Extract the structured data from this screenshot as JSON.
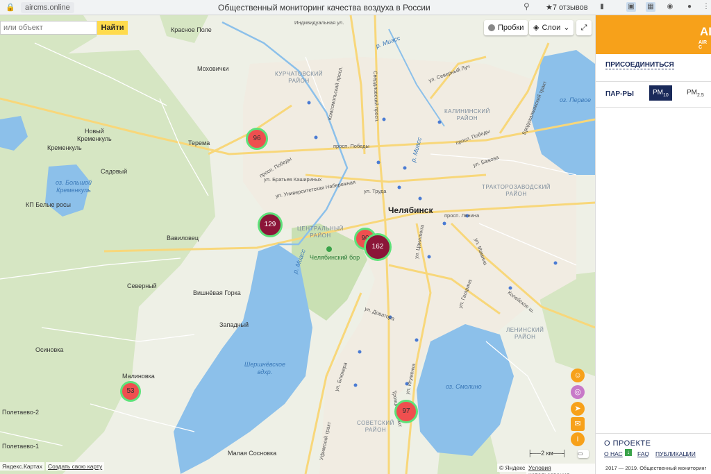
{
  "browser": {
    "lock_glyph": "🔒",
    "url": "aircms.online",
    "page_title": "Общественный мониторинг качества воздуха в России",
    "reviews": "★7 отзывов"
  },
  "search": {
    "placeholder": "или объект",
    "button": "Найти"
  },
  "map_controls": {
    "traffic": "Пробки",
    "layers": "Слои"
  },
  "places": {
    "krasnoe_pole": "Красное Поле",
    "mokhovichki": "Моховички",
    "novy_kremenkul": "Новый\nКременкуль",
    "kremenkul": "Кременкуль",
    "sadovy": "Садовый",
    "kp_belye_rosy": "КП Белые росы",
    "terema": "Терема",
    "vavilovets": "Вавиловец",
    "severny": "Северный",
    "vishnyovaya_gorka": "Вишнёвая Горка",
    "zapadny": "Западный",
    "osinovka": "Осиновка",
    "malinovka": "Малиновка",
    "poletaevo2": "Полетаево-2",
    "poletaevo1": "Полетаево-1",
    "malaya_sosnovka": "Малая Сосновка",
    "chelyabinsk": "Челябинск",
    "chelyabinsky_bor": "Челябинский бор"
  },
  "districts": {
    "kurchatovsky": "КУРЧАТОВСКИЙ\nРАЙОН",
    "kalininsky": "КАЛИНИНСКИЙ\nРАЙОН",
    "traktorozavodsky": "ТРАКТОРОЗАВОДСКИЙ\nРАЙОН",
    "centralny": "ЦЕНТРАЛЬНЫЙ\nРАЙОН",
    "leninsky": "ЛЕНИНСКИЙ\nРАЙОН",
    "sovetsky": "СОВЕТСКИЙ\nРАЙОН"
  },
  "streets": {
    "individualnaya": "Индивидуальная ул.",
    "komsomolsky": "Комсомольский просп.",
    "pobedy1": "просп. Победы",
    "pobedy2": "просп. Победы",
    "pobedy3": "просп. Победы",
    "bratyev": "ул. Братьев Кашириных",
    "universitetskaya": "ул. Университетская Набережная",
    "truda": "ул. Труда",
    "lenina": "просп. Ленина",
    "ufimsky": "Уфимский тракт",
    "blyukhera": "ул. Блюхера",
    "dovatora": "ул. Доватора",
    "igumnova": "ул. Игуменка",
    "tsvillinga": "ул. Цвиллинга",
    "sverdlovsky": "Свердловский просп.",
    "brodokalmaksky": "Бродокалмакский тракт",
    "kopeyskoe": "Копейское ш.",
    "bazhova": "ул. Бажова",
    "severny_luch": "ул. Северный Луч",
    "gagarina": "ул. Гагарина",
    "troitsky": "Троицкий тракт",
    "mamina": "ул. Мамина"
  },
  "water": {
    "bolshoy_kremenkul": "оз. Большой\nКременкуль",
    "shershnevskoe": "Шершнёвское\nвдхр.",
    "smolino": "оз. Смолино",
    "pervoe": "оз. Первое",
    "miass1": "р. Миасс",
    "miass2": "р. Миасс",
    "miass3": "р. Миасс"
  },
  "markers": [
    {
      "label": "96",
      "level": "red"
    },
    {
      "label": "129",
      "level": "maroon"
    },
    {
      "label": "90",
      "level": "red"
    },
    {
      "label": "162",
      "level": "maroon"
    },
    {
      "label": "53",
      "level": "red"
    },
    {
      "label": "97",
      "level": "red"
    }
  ],
  "scale_label": "2 км",
  "attribution": {
    "yandex_maps": "Яндекс.Картах",
    "create_map": "Создать свою карту",
    "copyright": "© Яндекс",
    "terms": "Условия использования"
  },
  "panel": {
    "brand": "AIR",
    "brand_sub": "AIR C",
    "join": "ПРИСОЕДИНИТЬСЯ",
    "params_label": "ПАР-РЫ",
    "pm10_base": "PM",
    "pm10_sub": "10",
    "pm25_base": "PM",
    "pm25_sub": "2.5",
    "about_title": "О ПРОЕКТЕ",
    "about_us": "О НАС",
    "faq": "FAQ",
    "publications": "ПУБЛИКАЦИИ",
    "footer": "2017 — 2019. Общественный мониторинг"
  },
  "colors": {
    "accent_orange": "#f7a11a",
    "navy": "#1a2a5a",
    "marker_red": "#ef4f4f",
    "marker_maroon": "#8b1538",
    "marker_ring": "#5ee27a",
    "water": "#8cc0ea"
  }
}
